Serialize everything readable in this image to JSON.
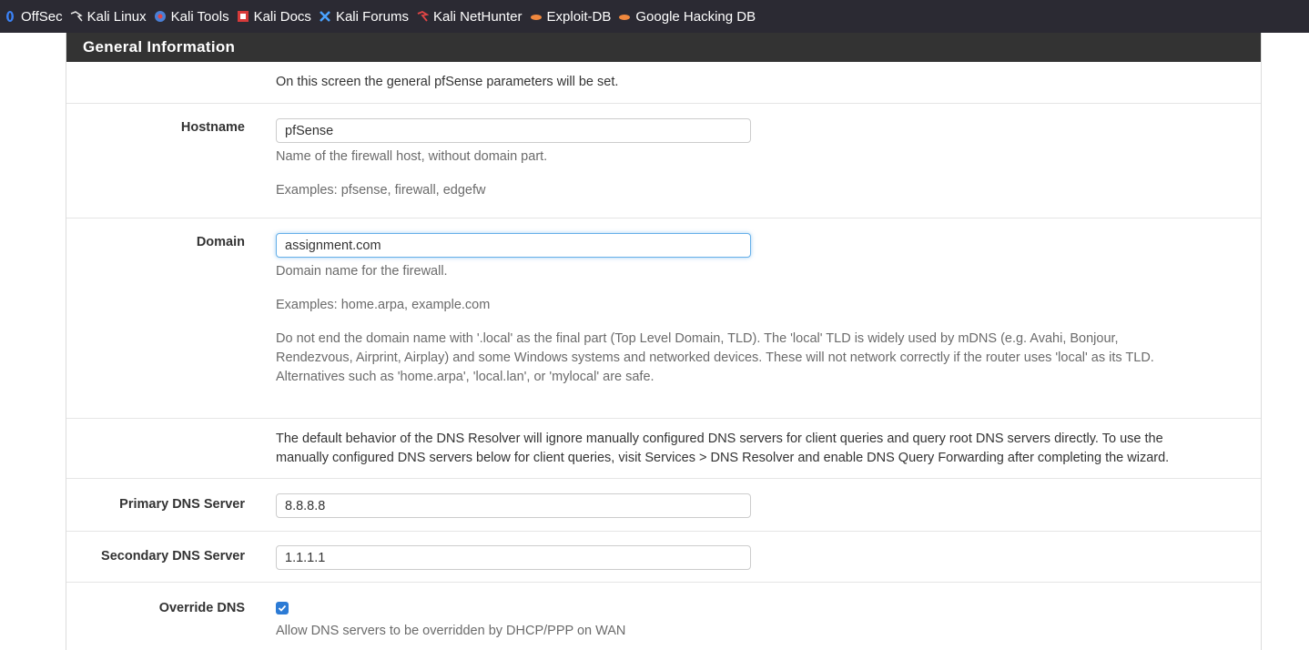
{
  "bookmarks": [
    {
      "label": "OffSec",
      "icon": "offsec-icon"
    },
    {
      "label": "Kali Linux",
      "icon": "kali-dragon-icon"
    },
    {
      "label": "Kali Tools",
      "icon": "kali-tools-icon"
    },
    {
      "label": "Kali Docs",
      "icon": "kali-docs-icon"
    },
    {
      "label": "Kali Forums",
      "icon": "kali-forums-icon"
    },
    {
      "label": "Kali NetHunter",
      "icon": "nethunter-icon"
    },
    {
      "label": "Exploit-DB",
      "icon": "exploit-db-icon"
    },
    {
      "label": "Google Hacking DB",
      "icon": "ghdb-icon"
    }
  ],
  "panel": {
    "title": "General Information"
  },
  "intro": "On this screen the general pfSense parameters will be set.",
  "hostname": {
    "label": "Hostname",
    "value": "pfSense",
    "help1": "Name of the firewall host, without domain part.",
    "help2": "Examples: pfsense, firewall, edgefw"
  },
  "domain": {
    "label": "Domain",
    "value": "assignment.com",
    "help1": "Domain name for the firewall.",
    "help2": "Examples: home.arpa, example.com",
    "help3_line1": "Do not end the domain name with '.local' as the final part (Top Level Domain, TLD). The 'local' TLD is widely used by mDNS (e.g. Avahi, Bonjour,",
    "help3_line2": "Rendezvous, Airprint, Airplay) and some Windows systems and networked devices. These will not network correctly if the router uses 'local' as its TLD.",
    "help3_line3": "Alternatives such as 'home.arpa', 'local.lan', or 'mylocal' are safe."
  },
  "dns_note_line1": "The default behavior of the DNS Resolver will ignore manually configured DNS servers for client queries and query root DNS servers directly. To use the",
  "dns_note_line2": "manually configured DNS servers below for client queries, visit Services > DNS Resolver and enable DNS Query Forwarding after completing the wizard.",
  "primary_dns": {
    "label": "Primary DNS Server",
    "value": "8.8.8.8"
  },
  "secondary_dns": {
    "label": "Secondary DNS Server",
    "value": "1.1.1.1"
  },
  "override_dns": {
    "label": "Override DNS",
    "checked": true,
    "help": "Allow DNS servers to be overridden by DHCP/PPP on WAN"
  },
  "colors": {
    "accent": "#2c7bd5",
    "heading_bg": "#333333",
    "toolbar_bg": "#2b2a33"
  }
}
